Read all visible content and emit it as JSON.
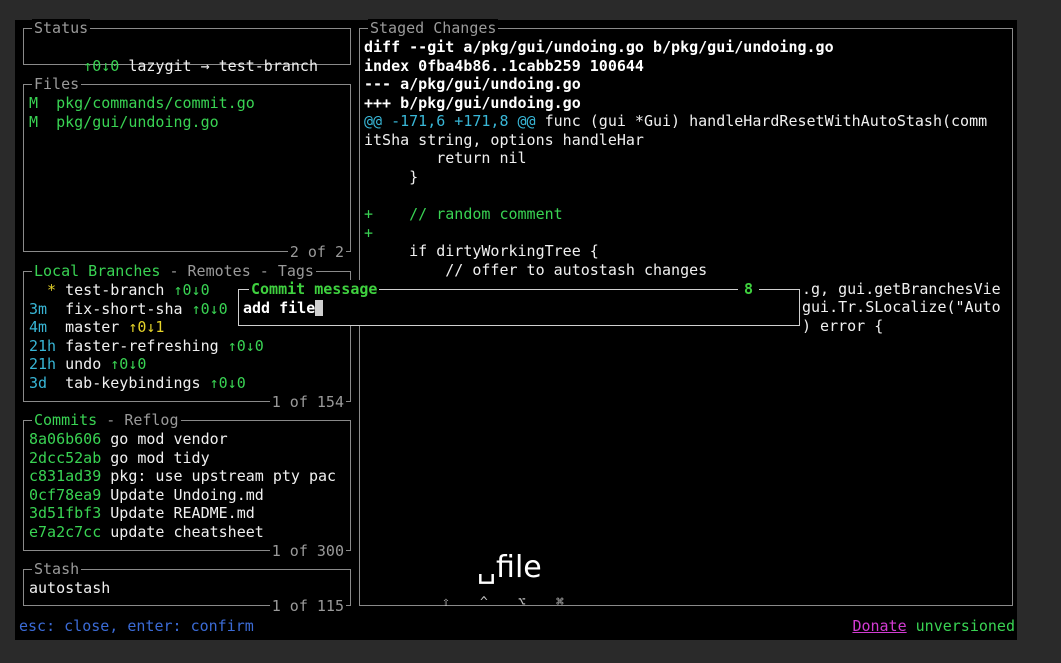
{
  "status": {
    "title": "Status",
    "arrows": "↑0↓0",
    "repo": "lazygit → test-branch"
  },
  "files": {
    "title": "Files",
    "items": [
      {
        "status": "M",
        "path": "pkg/commands/commit.go"
      },
      {
        "status": "M",
        "path": "pkg/gui/undoing.go"
      }
    ],
    "count": "2 of 2"
  },
  "branches": {
    "tab_active": "Local Branches",
    "tab_sep1": " - ",
    "tab_remotes": "Remotes",
    "tab_sep2": " - ",
    "tab_tags": "Tags",
    "items": [
      {
        "age": "  *",
        "name": "test-branch",
        "track": "↑0↓0"
      },
      {
        "age": "3m",
        "name": "fix-short-sha",
        "track": "↑0↓0"
      },
      {
        "age": "4m",
        "name": "master",
        "track": "↑0↓1"
      },
      {
        "age": "21h",
        "name": "faster-refreshing",
        "track": "↑0↓0"
      },
      {
        "age": "21h",
        "name": "undo",
        "track": "↑0↓0"
      },
      {
        "age": "3d",
        "name": "tab-keybindings",
        "track": "↑0↓0"
      }
    ],
    "count": "1 of 154"
  },
  "commits": {
    "tab_active": "Commits",
    "tab_sep": " - ",
    "tab_reflog": "Reflog",
    "items": [
      {
        "sha": "8a06b606",
        "msg": "go mod vendor"
      },
      {
        "sha": "2dcc52ab",
        "msg": "go mod tidy"
      },
      {
        "sha": "c831ad39",
        "msg": "pkg: use upstream pty pac"
      },
      {
        "sha": "0cf78ea9",
        "msg": "Update Undoing.md"
      },
      {
        "sha": "3d51fbf3",
        "msg": "Update README.md"
      },
      {
        "sha": "e7a2c7cc",
        "msg": "update cheatsheet"
      }
    ],
    "count": "1 of 300"
  },
  "stash": {
    "title": "Stash",
    "items": [
      "autostash"
    ],
    "count": "1 of 115"
  },
  "diff": {
    "title": "Staged Changes",
    "header1": "diff --git a/pkg/gui/undoing.go b/pkg/gui/undoing.go",
    "header2": "index 0fba4b86..1cabb259 100644",
    "header3": "--- a/pkg/gui/undoing.go",
    "header4": "+++ b/pkg/gui/undoing.go",
    "hunk_marker": "@@ -171,6 +171,8 @@",
    "hunk_ctx": " func (gui *Gui) handleHardResetWithAutoStash(comm",
    "wrap": "itSha string, options handleHar",
    "l1": "        return nil",
    "l2": "     }",
    "l3": "",
    "add1": "+    // random comment",
    "add2": "+",
    "l4": "     if dirtyWorkingTree {",
    "l5": "         // offer to autostash changes",
    "r1": ".g, gui.getBranchesVie",
    "r2": "gui.Tr.SLocalize(\"Auto",
    "r3": ") error {"
  },
  "commit_popup": {
    "title": "Commit message",
    "char_count": "8",
    "value": "add file"
  },
  "keystroke_overlay": {
    "text": "␣file",
    "modifiers": [
      "⇧",
      "^",
      "⌥",
      "⌘"
    ]
  },
  "footer": {
    "hint": "esc: close, enter: confirm",
    "donate": "Donate",
    "version": "unversioned"
  },
  "colors": {
    "accent": "#3fd13f",
    "hash": "#39d353",
    "hunk": "#38b6d6",
    "hint": "#3b6bd6",
    "donate": "#d23bd2"
  }
}
